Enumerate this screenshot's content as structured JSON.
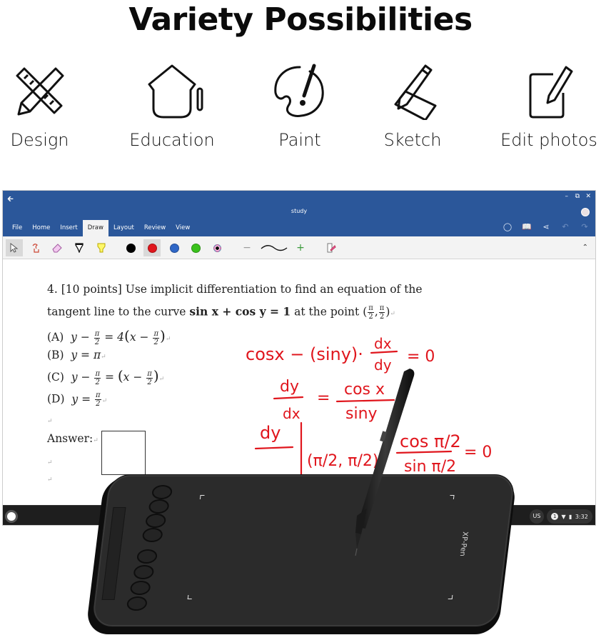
{
  "hero": {
    "title": "Variety Possibilities"
  },
  "features": [
    {
      "label": "Design",
      "icon": "ruler-pencil-icon"
    },
    {
      "label": "Education",
      "icon": "graduation-cap-icon"
    },
    {
      "label": "Paint",
      "icon": "palette-brush-icon"
    },
    {
      "label": "Sketch",
      "icon": "pencil-paper-icon"
    },
    {
      "label": "Edit photos",
      "icon": "edit-square-icon"
    }
  ],
  "app": {
    "document_title": "study",
    "back_icon": "back-arrow-icon",
    "window_controls": [
      "minimize-icon",
      "restore-icon",
      "close-icon"
    ],
    "tabs": [
      {
        "label": "File",
        "active": false
      },
      {
        "label": "Home",
        "active": false
      },
      {
        "label": "Insert",
        "active": false
      },
      {
        "label": "Draw",
        "active": true
      },
      {
        "label": "Layout",
        "active": false
      },
      {
        "label": "Review",
        "active": false
      },
      {
        "label": "View",
        "active": false
      }
    ],
    "ribbon_actions": [
      "tell-me-icon",
      "read-mode-icon",
      "share-icon",
      "undo-icon",
      "redo-icon"
    ],
    "draw_tools": {
      "tools": [
        "select-icon",
        "touch-draw-icon",
        "eraser-icon",
        "pen-icon",
        "highlighter-icon"
      ],
      "pen_colors": [
        {
          "name": "black",
          "hex": "#000000",
          "selected": false
        },
        {
          "name": "red",
          "hex": "#e0161d",
          "selected": true
        },
        {
          "name": "blue",
          "hex": "#2f67c7",
          "selected": false
        },
        {
          "name": "green",
          "hex": "#3ac21c",
          "selected": false
        },
        {
          "name": "multicolor",
          "hex": "#000000",
          "selected": false
        }
      ],
      "thickness_minus": "−",
      "thickness_plus": "+",
      "ink_to_shape": "ink-editor-icon"
    }
  },
  "document": {
    "question_line1": "4. [10 points] Use implicit differentiation to find an equation of the",
    "question_line2_prefix": "tangent line to the curve ",
    "question_equation": "sin x + cos y = 1",
    "question_line2_mid": " at the point ",
    "point": "(π/2, π/2)",
    "options": [
      {
        "label": "(A)",
        "math": "y − π/2 = 4(x − π/2)"
      },
      {
        "label": "(B)",
        "math": "y = π"
      },
      {
        "label": "(C)",
        "math": "y − π/2 = (x − π/2)"
      },
      {
        "label": "(D)",
        "math": "y = π/2"
      }
    ],
    "answer_label": "Answer:",
    "ink_color": "#e0161d",
    "handwriting": [
      "cosx − (siny)·dx/dy = 0",
      "dy/dx = cosx / siny",
      "dy/dx |(π/2, π/2) = cos(π/2) / sin(π/2) = 0"
    ]
  },
  "taskbar": {
    "keyboard_layout": "US",
    "notification_count": "1",
    "time": "3:32"
  },
  "tablet": {
    "brand": "XP-Pen",
    "express_key_count": 8
  }
}
